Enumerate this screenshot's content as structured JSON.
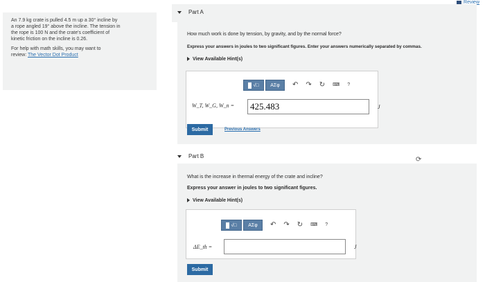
{
  "header": {
    "review_label": "Review"
  },
  "sidebar": {
    "problem_text_1": "An 7.9 kg crate is pulled 4.5 m up a 30° incline by",
    "problem_text_2": "a rope angled 19° above the incline. The tension in",
    "problem_text_3": "the rope is 100 N and the crate's coefficient of",
    "problem_text_4": "kinetic friction on the incline is 0.26.",
    "help_text_1": "For help with math skills, you may want to",
    "help_text_2": "review:",
    "help_link": "The Vector Dot Product"
  },
  "partA": {
    "title": "Part A",
    "question": "How much work is done by tension, by gravity, and by the normal force?",
    "instructions": "Express your answers in joules to two significant figures. Enter your answers numerically separated by commas.",
    "hints_label": "View Available Hint(s)",
    "toolbar": {
      "math_label": "√□",
      "greek_label": "ΑΣφ",
      "icons": [
        "undo-icon",
        "redo-icon",
        "reset-icon",
        "keyboard-icon",
        "help-icon"
      ]
    },
    "variable_label": "W_T, W_G, W_n =",
    "answer_value": "425.483",
    "unit": "J",
    "submit_label": "Submit",
    "previous_answers_label": "Previous Answers"
  },
  "partB": {
    "title": "Part B",
    "question": "What is the increase in thermal energy of the crate and incline?",
    "instructions": "Express your answer in joules to two significant figures.",
    "hints_label": "View Available Hint(s)",
    "toolbar": {
      "math_label": "√□",
      "greek_label": "ΑΣφ",
      "icons": [
        "undo-icon",
        "redo-icon",
        "reset-icon",
        "keyboard-icon",
        "help-icon"
      ]
    },
    "variable_label": "ΔE_th =",
    "answer_value": "",
    "unit": "J",
    "submit_label": "Submit"
  },
  "colors": {
    "panel_bg": "#f1f2f2",
    "toolbar_blue": "#5a7fa6",
    "submit_blue": "#2c6aa3",
    "link_blue": "#2a6fb0"
  }
}
